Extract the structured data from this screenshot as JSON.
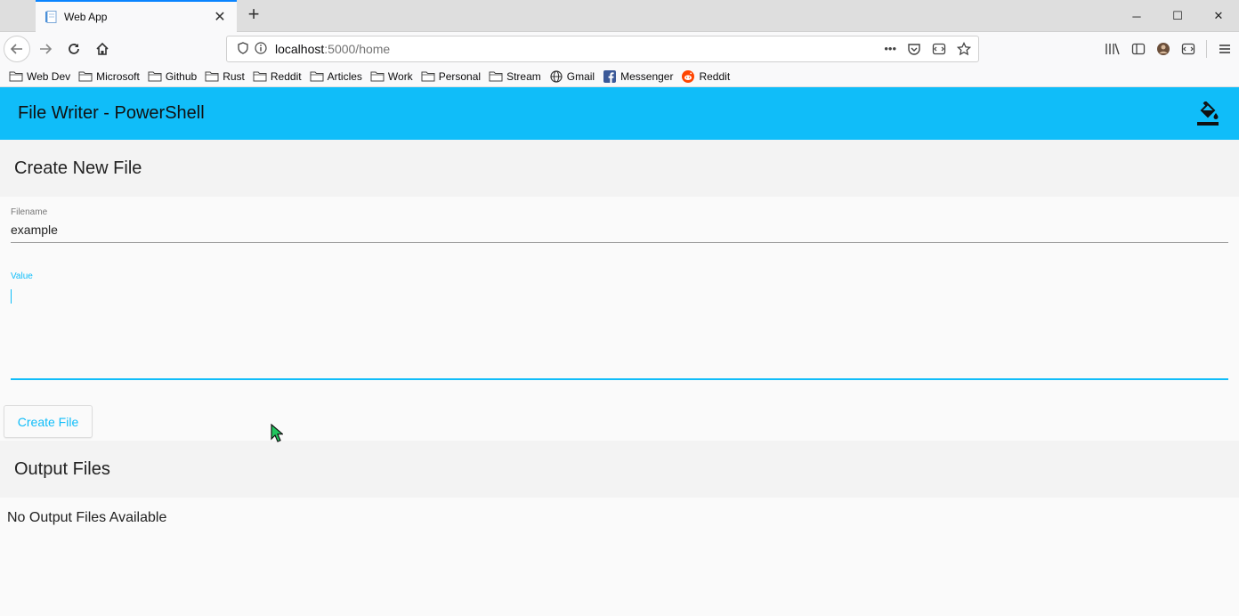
{
  "browser": {
    "tab_title": "Web App",
    "url_host": "localhost",
    "url_path": ":5000/home",
    "bookmarks": [
      {
        "label": "Web Dev",
        "icon": "folder-icon"
      },
      {
        "label": "Microsoft",
        "icon": "folder-icon"
      },
      {
        "label": "Github",
        "icon": "folder-icon"
      },
      {
        "label": "Rust",
        "icon": "folder-icon"
      },
      {
        "label": "Reddit",
        "icon": "folder-icon"
      },
      {
        "label": "Articles",
        "icon": "folder-icon"
      },
      {
        "label": "Work",
        "icon": "folder-icon"
      },
      {
        "label": "Personal",
        "icon": "folder-icon"
      },
      {
        "label": "Stream",
        "icon": "folder-icon"
      },
      {
        "label": "Gmail",
        "icon": "globe-icon"
      },
      {
        "label": "Messenger",
        "icon": "facebook-icon"
      },
      {
        "label": "Reddit",
        "icon": "reddit-icon"
      }
    ]
  },
  "app": {
    "title": "File Writer - PowerShell",
    "accent": "#10bdf9",
    "create_section": {
      "title": "Create New File",
      "filename_label": "Filename",
      "filename_value": "example",
      "value_label": "Value",
      "value_value": "",
      "submit_label": "Create File"
    },
    "output_section": {
      "title": "Output Files",
      "empty_message": "No Output Files Available"
    }
  }
}
